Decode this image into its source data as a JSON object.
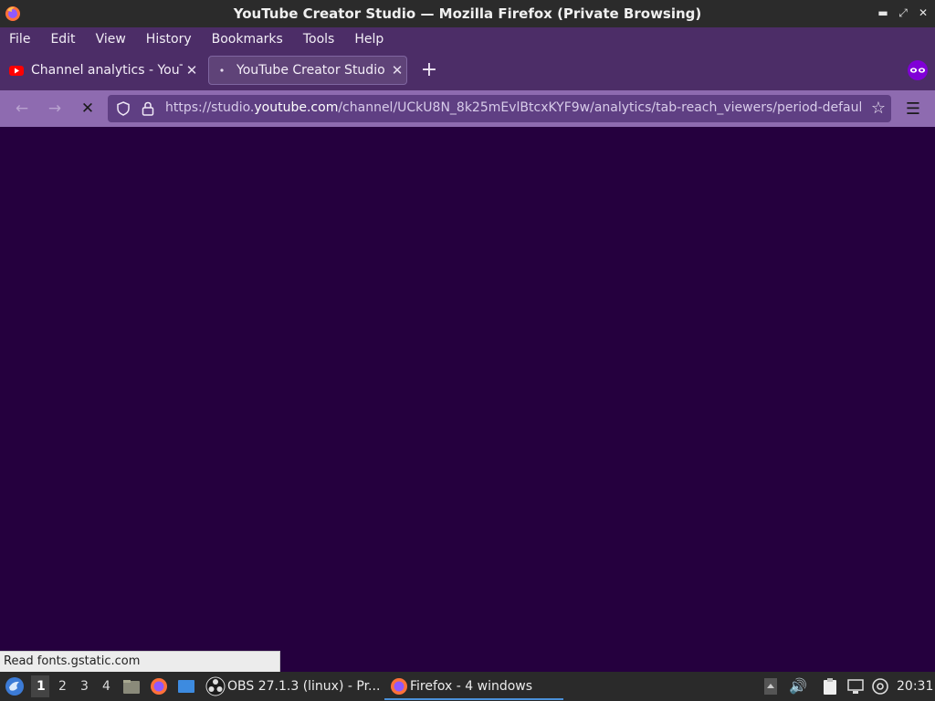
{
  "window": {
    "title": "YouTube Creator Studio — Mozilla Firefox (Private Browsing)",
    "controls": [
      "minimize",
      "maximize",
      "close"
    ]
  },
  "menubar": {
    "items": [
      "File",
      "Edit",
      "View",
      "History",
      "Bookmarks",
      "Tools",
      "Help"
    ]
  },
  "tabs": [
    {
      "label": "Channel analytics - YouTu",
      "icon": "youtube-icon",
      "active": false
    },
    {
      "label": "YouTube Creator Studio",
      "icon": "loading-icon",
      "active": true
    }
  ],
  "toolbar": {
    "new_tab": "+",
    "url_prefix": "https://studio.",
    "url_host": "youtube.com",
    "url_path": "/channel/UCkU8N_8k25mEvlBtcxKYF9w/analytics/tab-reach_viewers/period-defaul"
  },
  "status_bar": {
    "text": "Read fonts.gstatic.com"
  },
  "taskbar": {
    "workspaces": [
      "1",
      "2",
      "3",
      "4"
    ],
    "active_workspace": "1",
    "tasks": [
      {
        "label": "OBS 27.1.3 (linux) - Pr...",
        "icon": "obs-icon"
      },
      {
        "label": "Firefox - 4 windows",
        "icon": "firefox-icon"
      }
    ],
    "clock": "20:31"
  },
  "colors": {
    "content_bg": "#25003e",
    "tabbar_bg": "#4c2d67",
    "navbar_bg": "#8e6bb0",
    "urlbar_bg": "#5f3f83",
    "titlebar_bg": "#2b2b2b",
    "taskbar_bg": "#2a2a2a"
  }
}
